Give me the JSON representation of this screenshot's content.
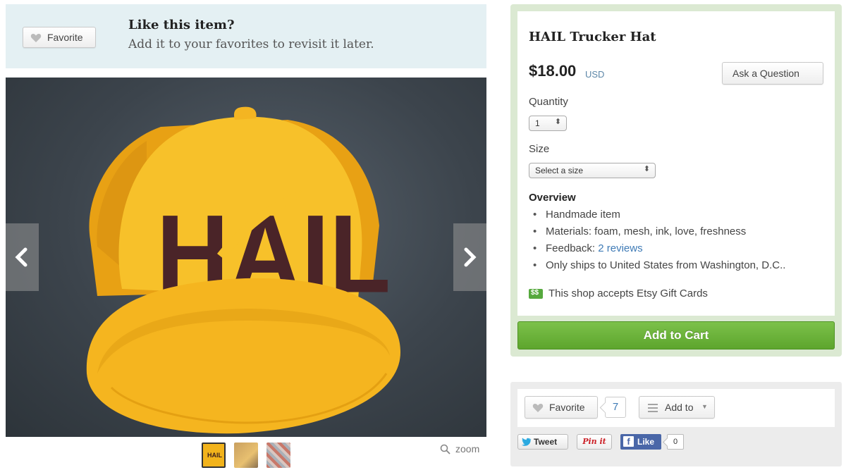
{
  "favorite_banner": {
    "button_label": "Favorite",
    "title": "Like this item?",
    "subtitle": "Add it to your favorites to revisit it later."
  },
  "gallery": {
    "hat_text": "HAIL",
    "zoom_label": "zoom",
    "thumbnail_label": "HAIL",
    "thumbnail_count": 3
  },
  "listing": {
    "title": "HAIL Trucker Hat",
    "price": "$18.00",
    "currency": "USD",
    "ask_button": "Ask a Question",
    "quantity_label": "Quantity",
    "quantity_value": "1",
    "size_label": "Size",
    "size_placeholder": "Select a size",
    "overview_title": "Overview",
    "overview": {
      "handmade": "Handmade item",
      "materials": "Materials: foam, mesh, ink, love, freshness",
      "feedback_prefix": "Feedback: ",
      "feedback_link": "2 reviews",
      "shipping": "Only ships to United States from Washington, D.C.."
    },
    "gift_icon_text": "$$",
    "gift_cards": "This shop accepts Etsy Gift Cards",
    "add_to_cart": "Add to Cart"
  },
  "social": {
    "favorite_label": "Favorite",
    "favorite_count": "7",
    "add_to_label": "Add to",
    "tweet_label": "Tweet",
    "pin_label": "Pin it",
    "like_label": "Like",
    "like_count": "0"
  },
  "colors": {
    "banner_bg": "#e4f0f3",
    "panel_bg": "#dbe9d2",
    "cart_green": "#6ab53a",
    "link_blue": "#3f7bb6",
    "hat_yellow": "#f5b51f",
    "hat_print": "#4a2428",
    "facebook_blue": "#4a67a8"
  }
}
